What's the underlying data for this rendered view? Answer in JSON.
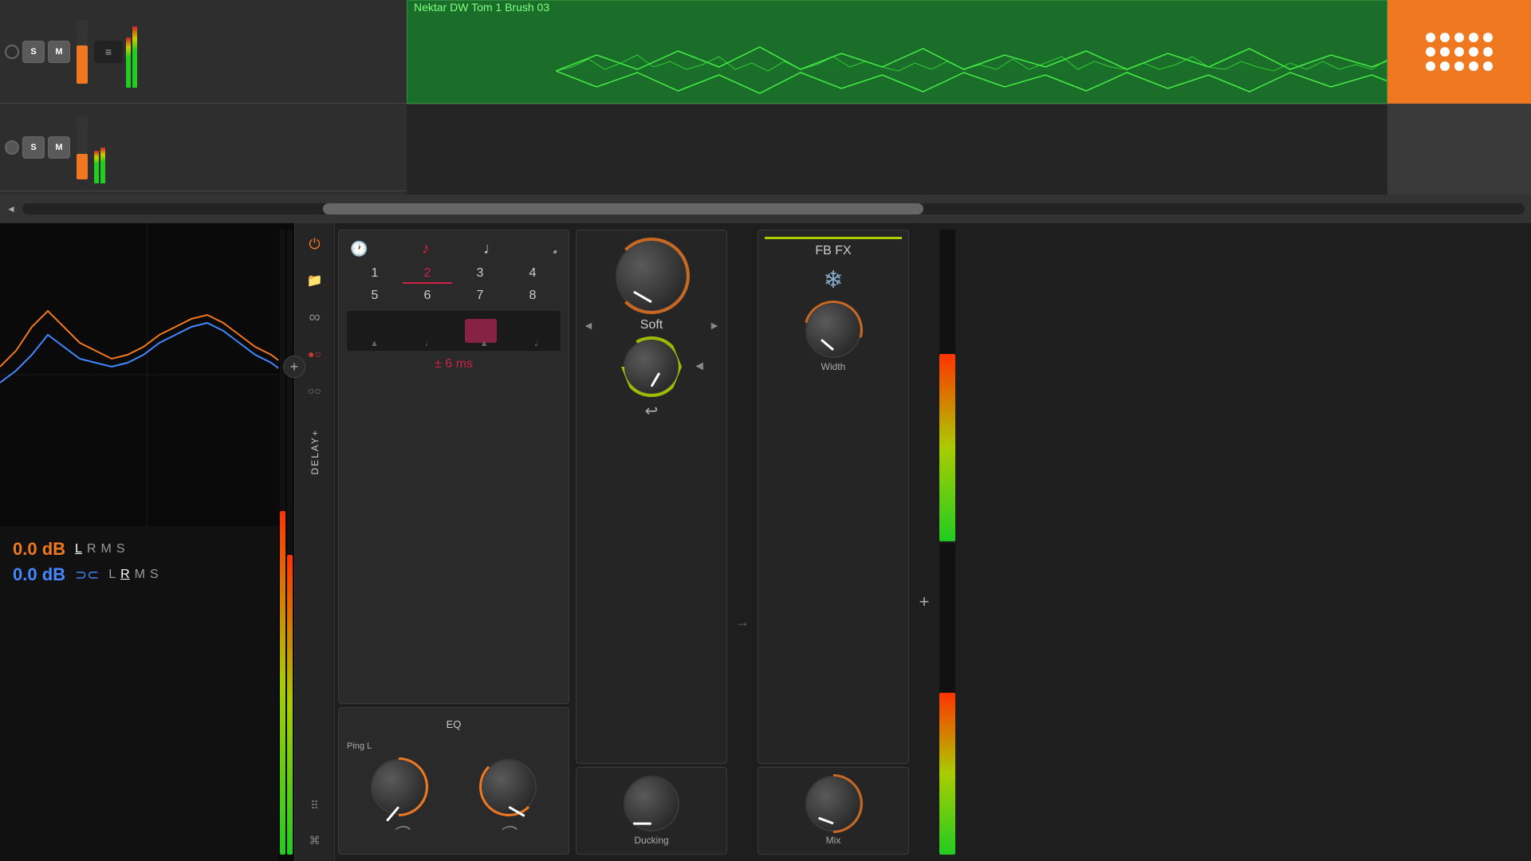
{
  "daw": {
    "track1": {
      "name": "Nektar DW Tom 1 Brush 03",
      "color": "#1a6e2a",
      "s_label": "S",
      "m_label": "M"
    },
    "track2": {
      "s_label": "S",
      "m_label": "M"
    }
  },
  "plugin": {
    "name": "DELAY+",
    "power_on": true,
    "tab_label": "Ping L",
    "note_icons": [
      "clock",
      "note-dotted",
      "note",
      "note-short"
    ],
    "grid": {
      "numbers": [
        "1",
        "2",
        "3",
        "4",
        "5",
        "6",
        "7",
        "8"
      ],
      "active": "2"
    },
    "time_ms": "± 6 ms",
    "eq_label": "EQ"
  },
  "soft_panel": {
    "name": "Soft",
    "knob1_label": "Soft",
    "knob2_label": "",
    "nav_prev": "◄",
    "nav_next": "►"
  },
  "fbfx_panel": {
    "title": "FB FX",
    "width_label": "Width",
    "mix_label": "Mix",
    "ducking_label": "Ducking"
  },
  "meters": {
    "left_db": "0.0 dB",
    "right_db": "0.0 dB",
    "l_label": "L",
    "r_label": "R",
    "m_label": "M",
    "s_label": "S"
  },
  "icons": {
    "power": "⏻",
    "folder": "🗂",
    "link": "∞",
    "record_circle": "⊙",
    "circles": "○○",
    "dots": "⋮⋮⋮",
    "key": "⌂",
    "snowflake": "❄",
    "return": "↩",
    "arrow_right": "→"
  },
  "colors": {
    "orange": "#f07820",
    "green": "#22cc22",
    "red_active": "#cc2244",
    "blue": "#4488ff",
    "lime": "#aacc00",
    "bg_dark": "#1e1e1e",
    "bg_mid": "#252525",
    "bg_light": "#2a2a2a"
  }
}
